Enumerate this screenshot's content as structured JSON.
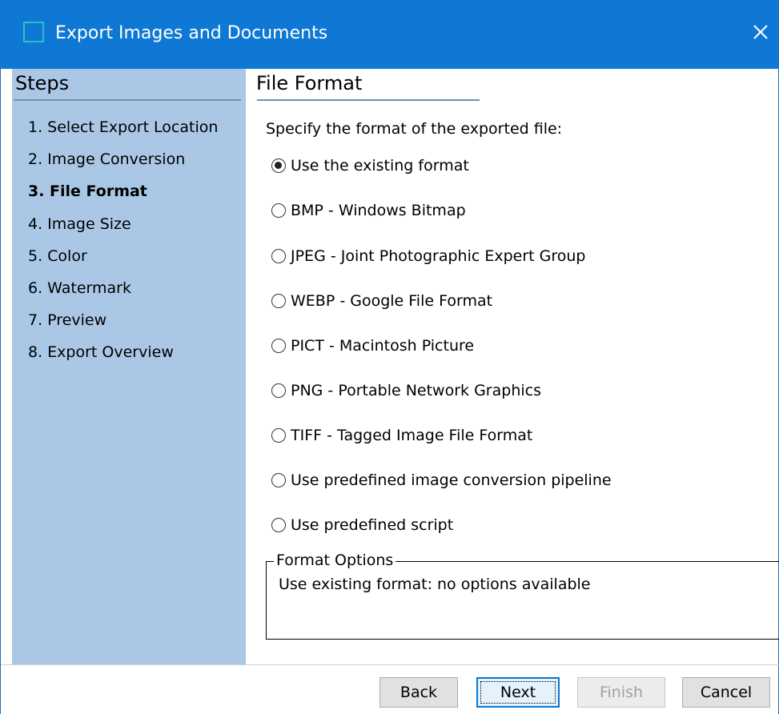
{
  "window": {
    "title": "Export Images and Documents",
    "close_glyph": "✕"
  },
  "sidebar": {
    "title": "Steps",
    "items": [
      {
        "label": "1. Select Export Location",
        "active": false
      },
      {
        "label": "2. Image Conversion",
        "active": false
      },
      {
        "label": "3. File Format",
        "active": true
      },
      {
        "label": "4. Image Size",
        "active": false
      },
      {
        "label": "5. Color",
        "active": false
      },
      {
        "label": "6. Watermark",
        "active": false
      },
      {
        "label": "7. Preview",
        "active": false
      },
      {
        "label": "8. Export Overview",
        "active": false
      }
    ]
  },
  "main": {
    "title": "File Format",
    "prompt": "Specify the format of the exported file:",
    "options": [
      {
        "label": "Use the existing format",
        "checked": true
      },
      {
        "label": "BMP - Windows Bitmap",
        "checked": false
      },
      {
        "label": "JPEG - Joint Photographic Expert Group",
        "checked": false
      },
      {
        "label": "WEBP - Google File Format",
        "checked": false
      },
      {
        "label": "PICT - Macintosh Picture",
        "checked": false
      },
      {
        "label": "PNG - Portable Network Graphics",
        "checked": false
      },
      {
        "label": "TIFF - Tagged Image File Format",
        "checked": false
      },
      {
        "label": "Use predefined image conversion pipeline",
        "checked": false
      },
      {
        "label": "Use predefined script",
        "checked": false
      }
    ],
    "format_options": {
      "legend": "Format Options",
      "text": "Use existing format: no options available"
    }
  },
  "footer": {
    "back": "Back",
    "next": "Next",
    "finish": "Finish",
    "cancel": "Cancel"
  },
  "colors": {
    "titlebar": "#0e78d4",
    "sidebar": "#abc7e6",
    "default_button_border": "#0078d7"
  },
  "icons": {
    "app": "app-window-icon",
    "close": "close-icon"
  }
}
